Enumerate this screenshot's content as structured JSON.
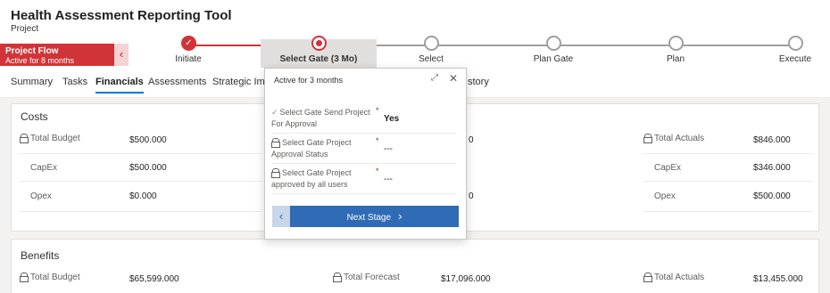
{
  "header": {
    "title": "Health Assessment Reporting Tool",
    "entity": "Project"
  },
  "process_flow": {
    "name": "Project Flow",
    "active_for": "Active for 8 months",
    "back_icon": "chevron-left-icon",
    "stages": [
      {
        "label": "Initiate",
        "state": "completed"
      },
      {
        "label": "Select Gate  (3 Mo)",
        "state": "active"
      },
      {
        "label": "Select",
        "state": "pending"
      },
      {
        "label": "Plan Gate",
        "state": "pending"
      },
      {
        "label": "Plan",
        "state": "pending"
      },
      {
        "label": "Execute",
        "state": "pending"
      }
    ]
  },
  "tabs": [
    "Summary",
    "Tasks",
    "Financials",
    "Assessments",
    "Strategic Imp",
    "story"
  ],
  "active_tab": "Financials",
  "costs": {
    "title": "Costs",
    "budget": [
      {
        "label": "Total Budget",
        "value": "$500.000",
        "locked": true
      },
      {
        "label": "CapEx",
        "value": "$500.000",
        "locked": false
      },
      {
        "label": "Opex",
        "value": "$0.000",
        "locked": false
      }
    ],
    "forecast_partial": [
      "0",
      "0"
    ],
    "actuals": [
      {
        "label": "Total Actuals",
        "value": "$846.000",
        "locked": true
      },
      {
        "label": "CapEx",
        "value": "$346.000",
        "locked": false
      },
      {
        "label": "Opex",
        "value": "$500.000",
        "locked": false
      }
    ]
  },
  "benefits": {
    "title": "Benefits",
    "fields": [
      {
        "label": "Total Budget",
        "value": "$65,599.000"
      },
      {
        "label": "Total Forecast",
        "value": "$17,096.000"
      },
      {
        "label": "Total Actuals",
        "value": "$13,455.000"
      }
    ]
  },
  "stage_flyout": {
    "status": "Active for 3 months",
    "expand_icon": "expand-icon",
    "close_icon": "close-icon",
    "fields": [
      {
        "label": "Select Gate Send Project For Approval",
        "value": "Yes",
        "icon": "check-icon",
        "required": "*"
      },
      {
        "label": "Select Gate Project Approval Status",
        "value": "---",
        "icon": "lock-icon",
        "required": "*"
      },
      {
        "label": "Select Gate Project approved by all users",
        "value": "---",
        "icon": "lock-icon",
        "required": "*"
      }
    ],
    "next_label": "Next Stage",
    "prev_icon": "chevron-left-icon",
    "next_icon": "chevron-right-icon"
  },
  "colors": {
    "accent_red": "#d13438",
    "accent_blue": "#2f6cb5",
    "tab_underline": "#0078d4"
  }
}
